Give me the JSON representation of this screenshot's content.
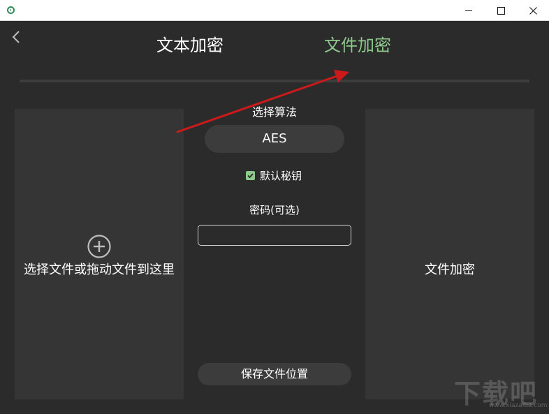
{
  "tabs": {
    "text_encrypt": "文本加密",
    "file_encrypt": "文件加密"
  },
  "left_panel": {
    "drop_label": "选择文件或拖动文件到这里"
  },
  "right_panel": {
    "encrypt_label": "文件加密"
  },
  "algorithm": {
    "label": "选择算法",
    "selected": "AES"
  },
  "default_key": {
    "label": "默认秘钥",
    "checked": true
  },
  "password": {
    "label": "密码(可选)",
    "value": ""
  },
  "save_location": {
    "label": "保存文件位置"
  },
  "watermark": {
    "text": "下载吧",
    "sub": "www.xiazaiba.com"
  },
  "colors": {
    "accent": "#8cc98a",
    "background": "#2b2b2b",
    "panel": "#353535",
    "annotation_arrow": "#cc1a1a"
  }
}
